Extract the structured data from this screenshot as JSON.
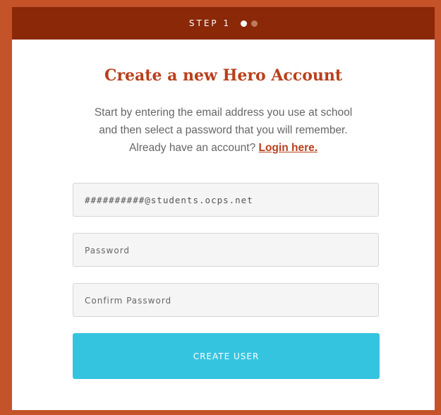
{
  "header": {
    "step_label": "STEP 1",
    "dots": [
      "active",
      "inactive"
    ]
  },
  "title": "Create a new Hero Account",
  "intro": {
    "line1": "Start by entering the email address you use at school",
    "line2": "and then select a password that you will remember.",
    "line3_prefix": "Already have an account? ",
    "login_link": "Login here."
  },
  "form": {
    "email_value": "##########@students.ocps.net",
    "password_placeholder": "Password",
    "confirm_placeholder": "Confirm Password",
    "submit_label": "CREATE USER"
  },
  "colors": {
    "frame": "#c4532a",
    "header": "#8a2808",
    "title": "#b8401c",
    "button": "#35c4e0"
  }
}
